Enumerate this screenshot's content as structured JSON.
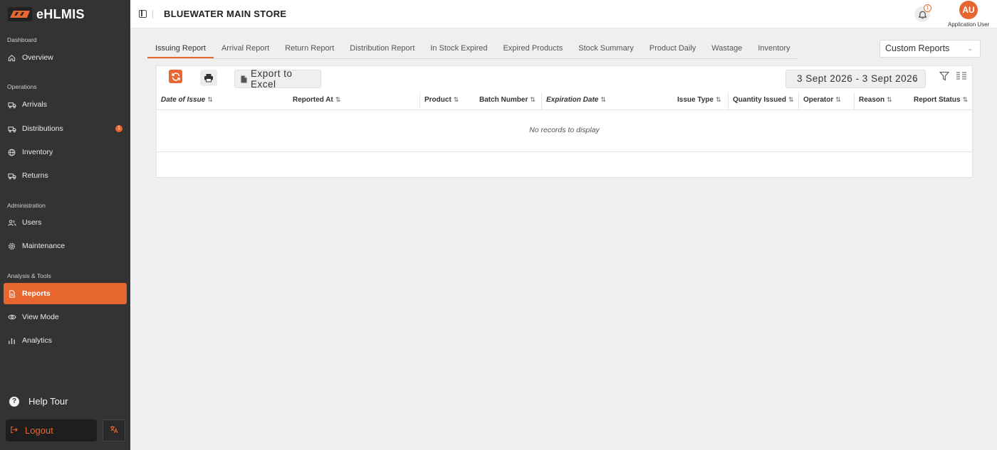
{
  "brand": {
    "name": "eHLMIS"
  },
  "sidebar": {
    "sections": {
      "dashboard": "Dashboard",
      "operations": "Operations",
      "administration": "Administration",
      "analysis": "Analysis & Tools"
    },
    "items": {
      "overview": "Overview",
      "arrivals": "Arrivals",
      "distributions": "Distributions",
      "distributions_badge": "1",
      "inventory": "Inventory",
      "returns": "Returns",
      "users": "Users",
      "maintenance": "Maintenance",
      "reports": "Reports",
      "view_mode": "View Mode",
      "analytics": "Analytics"
    },
    "help_tour": "Help Tour",
    "logout": "Logout"
  },
  "header": {
    "store_title": "BLUEWATER MAIN STORE",
    "notification_count": "1",
    "avatar_initials": "AU",
    "user_name": "Application User"
  },
  "tabs": [
    {
      "label": "Issuing Report",
      "active": true
    },
    {
      "label": "Arrival Report"
    },
    {
      "label": "Return Report"
    },
    {
      "label": "Distribution Report"
    },
    {
      "label": "In Stock Expired"
    },
    {
      "label": "Expired Products"
    },
    {
      "label": "Stock Summary"
    },
    {
      "label": "Product Daily"
    },
    {
      "label": "Wastage"
    },
    {
      "label": "Inventory"
    }
  ],
  "custom_reports": "Custom Reports",
  "toolbar": {
    "export_label": "Export to Excel",
    "date_range": "3 Sept 2026 - 3 Sept 2026"
  },
  "table": {
    "columns": [
      {
        "label": "Date of Issue"
      },
      {
        "label": "Reported At"
      },
      {
        "label": "Product"
      },
      {
        "label": "Batch Number"
      },
      {
        "label": "Expiration Date"
      },
      {
        "label": "Issue Type"
      },
      {
        "label": "Quantity Issued"
      },
      {
        "label": "Operator"
      },
      {
        "label": "Reason"
      },
      {
        "label": "Report Status"
      }
    ],
    "empty_message": "No records to display"
  },
  "colors": {
    "accent": "#e8662f",
    "sidebar_bg": "#333333",
    "page_bg": "#efefef"
  }
}
